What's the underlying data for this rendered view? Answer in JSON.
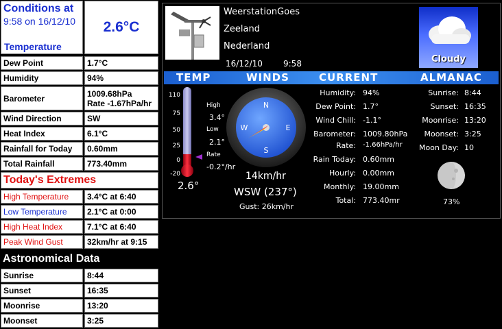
{
  "conditions": {
    "title": "Conditions at",
    "time_line": "9:58 on 16/12/10",
    "temp_label": "Temperature",
    "temperature": "2.6°C"
  },
  "rows": [
    {
      "label": "Dew Point",
      "value": "1.7°C"
    },
    {
      "label": "Humidity",
      "value": "94%"
    },
    {
      "label": "Barometer",
      "value": "1009.68hPa",
      "value2": "Rate -1.67hPa/hr"
    },
    {
      "label": "Wind Direction",
      "value": "SW"
    },
    {
      "label": "Heat Index",
      "value": "6.1°C"
    },
    {
      "label": "Rainfall for Today",
      "value": "0.60mm"
    },
    {
      "label": "Total Rainfall",
      "value": "773.40mm"
    }
  ],
  "extremes_title": "Today's Extremes",
  "extremes": [
    {
      "label": "High Temperature",
      "value": "3.4°C at 6:40",
      "color": "#e01010"
    },
    {
      "label": "Low Temperature",
      "value": "2.1°C at 0:00",
      "color": "#1a2fd0"
    },
    {
      "label": "High Heat Index",
      "value": "7.1°C at 6:40",
      "color": "#e01010"
    },
    {
      "label": "Peak Wind Gust",
      "value": "32km/hr at 9:15",
      "color": "#e01010"
    }
  ],
  "astro_title": "Astronomical Data",
  "astro": [
    {
      "label": "Sunrise",
      "value": "8:44"
    },
    {
      "label": "Sunset",
      "value": "16:35"
    },
    {
      "label": "Moonrise",
      "value": "13:20"
    },
    {
      "label": "Moonset",
      "value": "3:25"
    }
  ],
  "station": {
    "name": "WeerstationGoes",
    "region": "Zeeland",
    "country": "Nederland",
    "date": "16/12/10",
    "time": "9:58",
    "forecast": "Cloudy"
  },
  "sections": [
    "TEMP",
    "WINDS",
    "CURRENT",
    "ALMANAC"
  ],
  "thermo": {
    "ticks": [
      "110",
      "75",
      "50",
      "25",
      "0",
      "-20"
    ],
    "high_label": "High",
    "high": "3.4°",
    "low_label": "Low",
    "low": "2.1°",
    "rate_label": "Rate",
    "rate": "-0.2°/hr",
    "current": "2.6°",
    "level_fraction": 0.17,
    "accent": "#c8102e"
  },
  "wind": {
    "compass": [
      "N",
      "E",
      "S",
      "W"
    ],
    "speed": "14km/hr",
    "direction": "WSW (237°)",
    "gust": "Gust:  26km/hr",
    "bearing_deg": 237,
    "dial_color": "#2a6ef0"
  },
  "current": [
    {
      "label": "Humidity:",
      "value": "94%"
    },
    {
      "label": "Dew Point:",
      "value": "1.7°"
    },
    {
      "label": "Wind Chill:",
      "value": "-1.1°"
    },
    {
      "label": "Barometer:",
      "value": "1009.80hPa"
    },
    {
      "label": "Rate:",
      "value": "-1.66hPa/hr"
    },
    {
      "label": "Rain Today:",
      "value": "0.60mm"
    },
    {
      "label": "Hourly:",
      "value": "0.00mm"
    },
    {
      "label": "Monthly:",
      "value": "19.00mm"
    },
    {
      "label": "Total:",
      "value": "773.40mr"
    }
  ],
  "almanac": [
    {
      "label": "Sunrise:",
      "value": "8:44"
    },
    {
      "label": "Sunset:",
      "value": "16:35"
    },
    {
      "label": "Moonrise:",
      "value": "13:20"
    },
    {
      "label": "Moonset:",
      "value": "3:25"
    },
    {
      "label": "Moon Day:",
      "value": "10"
    }
  ],
  "moon_percent": "73%",
  "icons": {
    "station": "weather-station-icon",
    "forecast": "cloud-icon",
    "moon": "moon-phase-icon",
    "compass": "compass-icon",
    "thermometer": "thermometer-icon"
  }
}
